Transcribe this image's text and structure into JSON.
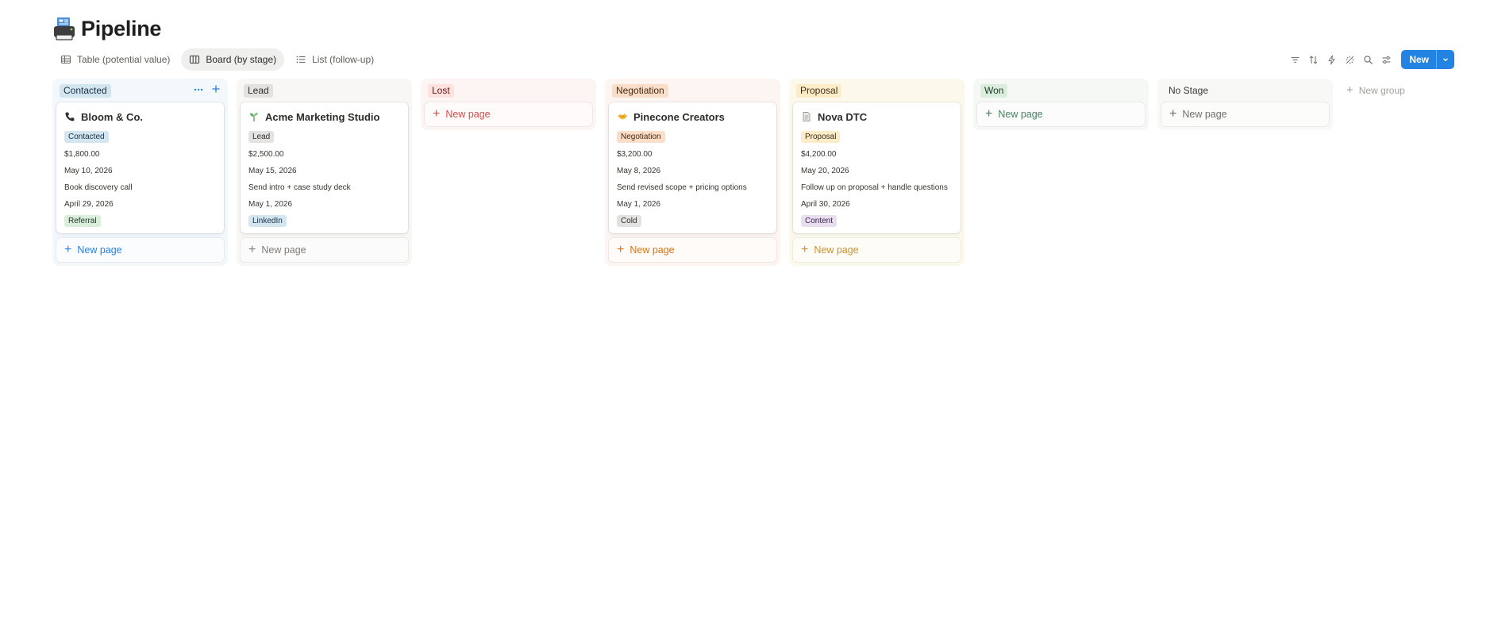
{
  "page": {
    "title": "Pipeline",
    "icon": "printer-icon"
  },
  "tabs": [
    {
      "label": "Table (potential value)",
      "icon": "table-icon",
      "active": false
    },
    {
      "label": "Board (by stage)",
      "icon": "board-icon",
      "active": true
    },
    {
      "label": "List (follow-up)",
      "icon": "list-icon",
      "active": false
    }
  ],
  "toolbar": {
    "icons": [
      "filter-icon",
      "sort-icon",
      "automation-icon",
      "ai-sparkle-icon",
      "search-icon",
      "settings-icon"
    ],
    "new_label": "New"
  },
  "colors": {
    "accent": "#2383e2",
    "contacted_bg": "#f3f8fc",
    "lead_bg": "#f8f7f5",
    "lost_bg": "#fdf5f4",
    "negotiation_bg": "#fcf5f1",
    "proposal_bg": "#fcf9ec",
    "won_bg": "#f5f8f5",
    "nostage_bg": "#f8f8f7"
  },
  "board": {
    "new_page_label": "New page",
    "new_group_label": "New group",
    "columns": [
      {
        "stage": "Contacted",
        "cards": [
          {
            "title": "Bloom & Co.",
            "icon": "phone-icon",
            "stage_tag": "Contacted",
            "value": "$1,800.00",
            "close_date": "May 10, 2026",
            "next_step": "Book discovery call",
            "follow_up": "April 29, 2026",
            "source": "Referral"
          }
        ]
      },
      {
        "stage": "Lead",
        "cards": [
          {
            "title": "Acme Marketing Studio",
            "icon": "seedling-icon",
            "stage_tag": "Lead",
            "value": "$2,500.00",
            "close_date": "May 15, 2026",
            "next_step": "Send intro + case study deck",
            "follow_up": "May 1, 2026",
            "source": "LinkedIn"
          }
        ]
      },
      {
        "stage": "Lost",
        "cards": []
      },
      {
        "stage": "Negotiation",
        "cards": [
          {
            "title": "Pinecone Creators",
            "icon": "handshake-icon",
            "stage_tag": "Negotiation",
            "value": "$3,200.00",
            "close_date": "May 8, 2026",
            "next_step": "Send revised scope + pricing options",
            "follow_up": "May 1, 2026",
            "source": "Cold"
          }
        ]
      },
      {
        "stage": "Proposal",
        "cards": [
          {
            "title": "Nova DTC",
            "icon": "document-icon",
            "stage_tag": "Proposal",
            "value": "$4,200.00",
            "close_date": "May 20, 2026",
            "next_step": "Follow up on proposal + handle questions",
            "follow_up": "April 30, 2026",
            "source": "Content"
          }
        ]
      },
      {
        "stage": "Won",
        "cards": []
      },
      {
        "stage": "No Stage",
        "cards": []
      }
    ]
  }
}
